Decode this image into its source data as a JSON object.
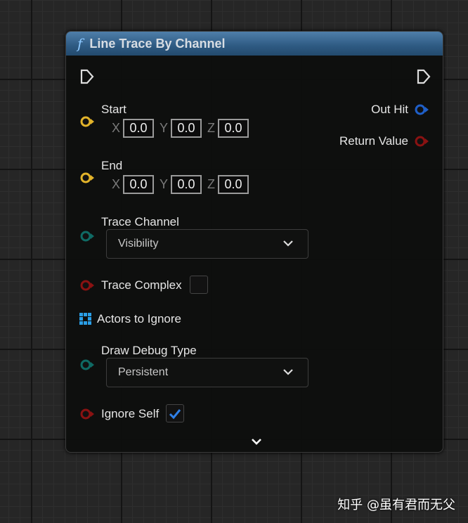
{
  "node": {
    "title": "Line Trace By Channel",
    "func_glyph": "f"
  },
  "inputs": {
    "start": {
      "label": "Start",
      "x": "0.0",
      "y": "0.0",
      "z": "0.0"
    },
    "end": {
      "label": "End",
      "x": "0.0",
      "y": "0.0",
      "z": "0.0"
    },
    "axis_labels": {
      "x": "X",
      "y": "Y",
      "z": "Z"
    },
    "trace_channel": {
      "label": "Trace Channel",
      "value": "Visibility"
    },
    "trace_complex": {
      "label": "Trace Complex",
      "checked": false
    },
    "actors_to_ignore": {
      "label": "Actors to Ignore"
    },
    "draw_debug_type": {
      "label": "Draw Debug Type",
      "value": "Persistent"
    },
    "ignore_self": {
      "label": "Ignore Self",
      "checked": true
    }
  },
  "outputs": {
    "out_hit": "Out Hit",
    "return_value": "Return Value"
  },
  "watermark": "知乎 @虽有君而无父",
  "colors": {
    "vector": "#e2b32a",
    "struct": "#1f5fc8",
    "bool": "#8a1212",
    "byte": "#0f6a64",
    "array": "#2a9ee6"
  }
}
